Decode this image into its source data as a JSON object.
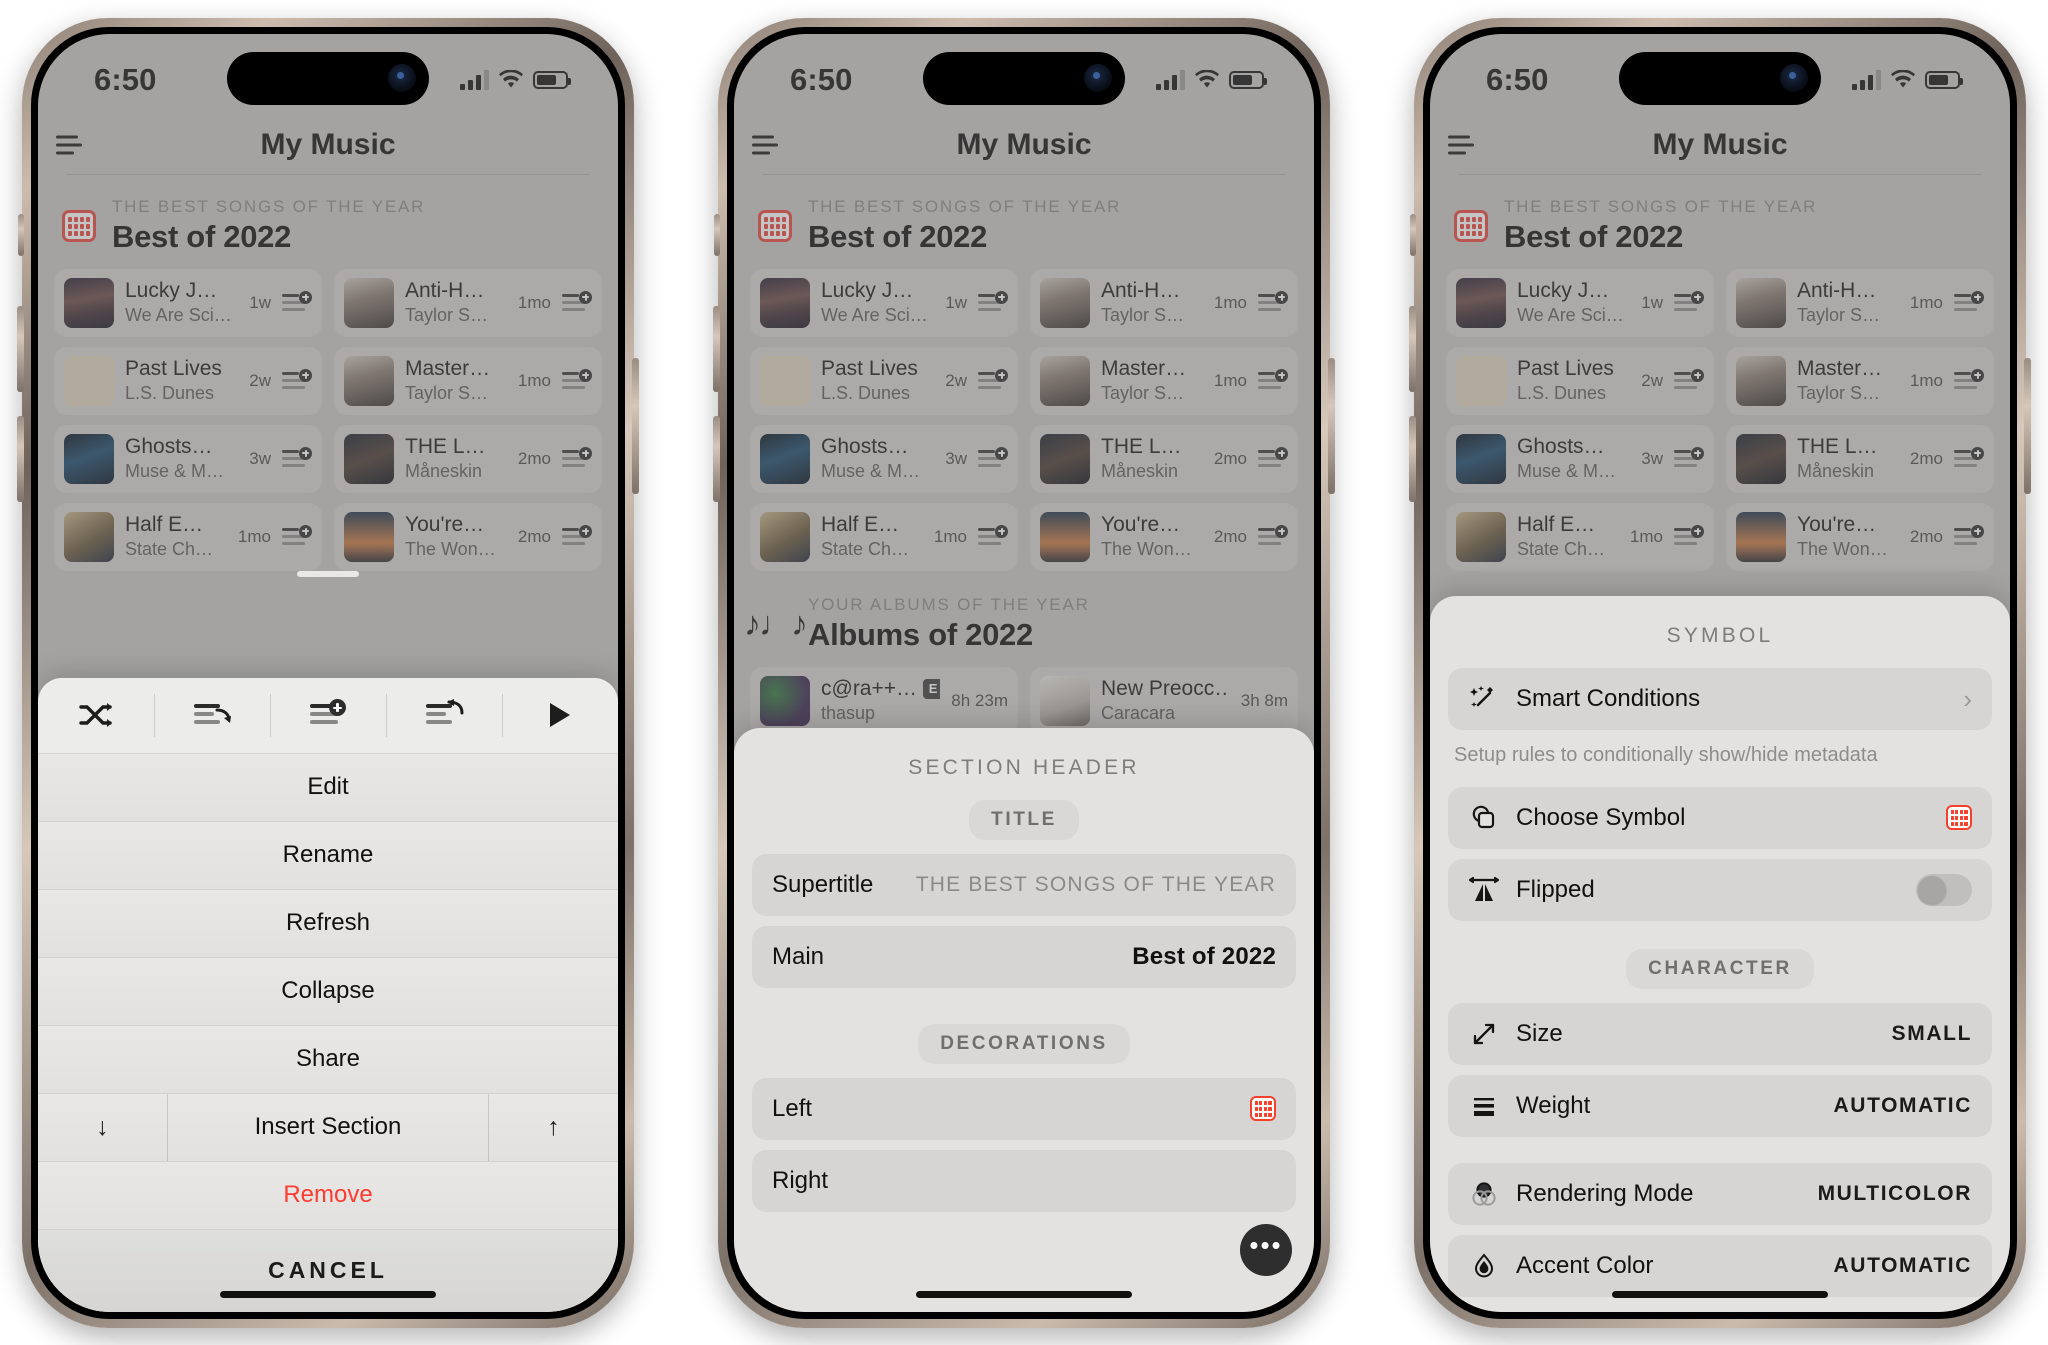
{
  "status_bar": {
    "time": "6:50",
    "signal_icon": "cellular-signal-icon",
    "wifi_icon": "wifi-icon",
    "battery_icon": "battery-icon"
  },
  "nav": {
    "title": "My Music",
    "menu_icon": "hamburger-menu-icon"
  },
  "sections": {
    "songs": {
      "supertitle": "THE BEST SONGS OF THE YEAR",
      "title": "Best of 2022",
      "icon": "calendar-icon",
      "items": [
        {
          "title": "Lucky J…",
          "artist": "We Are Sci…",
          "age": "1w",
          "action_icon": "add-to-playlist-icon"
        },
        {
          "title": "Anti-H…",
          "artist": "Taylor S…",
          "age": "1mo",
          "action_icon": "add-to-playlist-icon"
        },
        {
          "title": "Past Lives",
          "artist": "L.S. Dunes",
          "age": "2w",
          "action_icon": "add-to-playlist-icon"
        },
        {
          "title": "Master…",
          "artist": "Taylor S…",
          "age": "1mo",
          "action_icon": "add-to-playlist-icon"
        },
        {
          "title": "Ghosts…",
          "artist": "Muse & M…",
          "age": "3w",
          "action_icon": "add-to-playlist-icon"
        },
        {
          "title": "THE L…",
          "artist": "Måneskin",
          "age": "2mo",
          "action_icon": "add-to-playlist-icon"
        },
        {
          "title": "Half E…",
          "artist": "State Ch…",
          "age": "1mo",
          "action_icon": "add-to-playlist-icon"
        },
        {
          "title": "You're…",
          "artist": "The Won…",
          "age": "2mo",
          "action_icon": "add-to-playlist-icon"
        }
      ]
    },
    "albums": {
      "supertitle": "YOUR ALBUMS OF THE YEAR",
      "title": "Albums of 2022",
      "icon": "music-notes-icon",
      "items": [
        {
          "title": "c@ra++…",
          "artist": "thasup",
          "explicit": "E",
          "duration": "8h 23m"
        },
        {
          "title": "New Preocc…",
          "artist": "Caracara",
          "duration": "3h 8m"
        }
      ]
    }
  },
  "action_sheet": {
    "toolbar": [
      {
        "icon": "shuffle-icon"
      },
      {
        "icon": "play-next-icon"
      },
      {
        "icon": "add-to-playlist-icon"
      },
      {
        "icon": "replace-queue-icon"
      },
      {
        "icon": "play-icon"
      }
    ],
    "items": [
      {
        "label": "Edit"
      },
      {
        "label": "Rename"
      },
      {
        "label": "Refresh"
      },
      {
        "label": "Collapse"
      },
      {
        "label": "Share"
      },
      {
        "label": "Insert Section",
        "left_icon": "arrow-down-icon",
        "left_glyph": "↓",
        "right_icon": "arrow-up-icon",
        "right_glyph": "↑"
      },
      {
        "label": "Remove",
        "style": "destructive"
      }
    ],
    "cancel_label": "CANCEL"
  },
  "section_header_sheet": {
    "title": "SECTION HEADER",
    "groups": [
      {
        "pill": "TITLE",
        "rows": [
          {
            "label": "Supertitle",
            "value": "THE BEST SONGS OF THE YEAR",
            "value_style": "caps-muted"
          },
          {
            "label": "Main",
            "value": "Best of 2022",
            "value_style": "strong"
          }
        ]
      },
      {
        "pill": "DECORATIONS",
        "rows": [
          {
            "label": "Left",
            "value": "",
            "accessory": "calendar-icon"
          },
          {
            "label": "Right",
            "value": "",
            "accessory": "none"
          }
        ]
      }
    ],
    "more_button": {
      "icon": "more-ellipsis-icon",
      "glyph": "•••"
    }
  },
  "symbol_sheet": {
    "title": "SYMBOL",
    "rows": [
      {
        "label": "Smart Conditions",
        "icon": "magic-wand-icon",
        "accessory": "chevron-right-icon",
        "accessory_glyph": "›"
      },
      {
        "label": "Choose Symbol",
        "icon": "copy-shapes-icon",
        "accessory": "calendar-icon"
      },
      {
        "label": "Flipped",
        "icon": "flip-horizontal-icon",
        "accessory": "toggle-off"
      }
    ],
    "hint": "Setup rules to conditionally show/hide metadata",
    "pill": "CHARACTER",
    "character_rows": [
      {
        "label": "Size",
        "icon": "resize-arrows-icon",
        "value": "SMALL"
      },
      {
        "label": "Weight",
        "icon": "weight-lines-icon",
        "value": "AUTOMATIC"
      },
      {
        "label": "Rendering Mode",
        "icon": "venn-circles-icon",
        "value": "MULTICOLOR"
      },
      {
        "label": "Accent Color",
        "icon": "droplet-icon",
        "value": "AUTOMATIC"
      }
    ]
  },
  "colors": {
    "accent_red": "#f5402c",
    "destructive": "#ff3b30",
    "sheet_bg": "#e3e2e1"
  }
}
